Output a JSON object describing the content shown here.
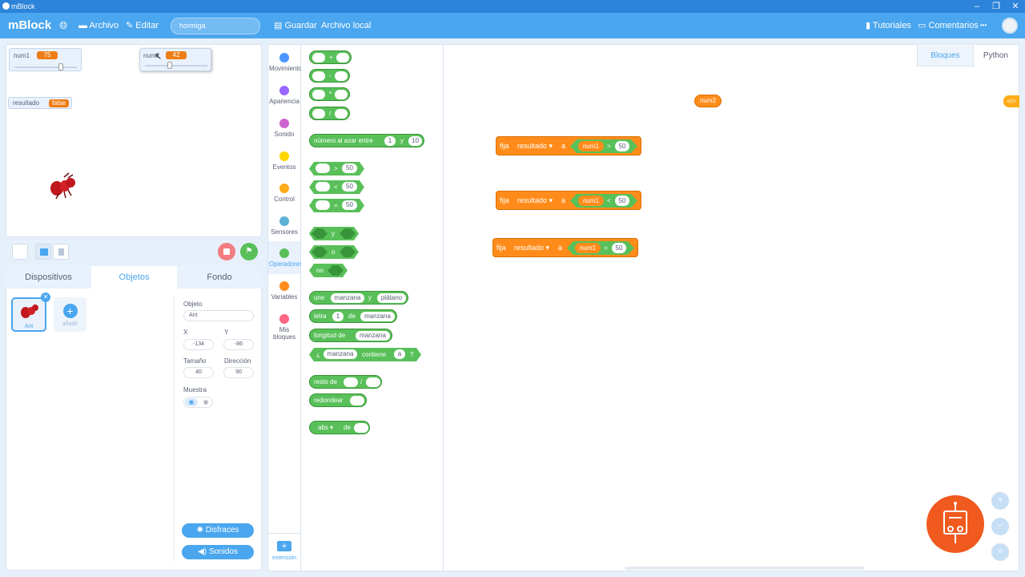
{
  "window": {
    "title": "mBlock"
  },
  "menu": {
    "logo": "mBlock",
    "file": "Archivo",
    "edit": "Editar",
    "project_name": "hormiga",
    "save": "Guardar",
    "local_file": "Archivo local",
    "tutorials": "Tutoriales",
    "comments": "Comentarios",
    "more": "•••"
  },
  "stage": {
    "monitors": [
      {
        "name": "num1",
        "value": "75"
      },
      {
        "name": "num2",
        "value": "42"
      },
      {
        "name": "resultado",
        "value": "false"
      }
    ]
  },
  "tabs": {
    "devices": "Dispositivos",
    "sprites": "Objetos",
    "background": "Fondo"
  },
  "sprite_panel": {
    "sprite_name": "Ant",
    "add_label": "añadir",
    "object_label": "Objeto",
    "object_value": "Ant",
    "x_label": "X",
    "x_value": "-134",
    "y_label": "Y",
    "y_value": "-86",
    "size_label": "Tamaño",
    "size_value": "40",
    "direction_label": "Dirección",
    "direction_value": "90",
    "show_label": "Muestra",
    "costumes_button": "Disfraces",
    "sounds_button": "Sonidos"
  },
  "categories": [
    {
      "label": "Movimiento",
      "color": "#4c97ff"
    },
    {
      "label": "Apariencia",
      "color": "#9966ff"
    },
    {
      "label": "Sonido",
      "color": "#cf63cf"
    },
    {
      "label": "Eventos",
      "color": "#ffd500"
    },
    {
      "label": "Control",
      "color": "#ffab19"
    },
    {
      "label": "Sensores",
      "color": "#5cb1d6"
    },
    {
      "label": "Operadores",
      "color": "#59c059"
    },
    {
      "label": "Variables",
      "color": "#ff8c1a"
    },
    {
      "label": "Mis bloques",
      "color": "#ff6680"
    }
  ],
  "extension_label": "extensión",
  "palette": {
    "op_add": "+",
    "op_sub": "-",
    "op_mul": "*",
    "op_div": "/",
    "random_text": "número al azar entre",
    "random_from": "1",
    "random_and": "y",
    "random_to": "10",
    "gt": ">",
    "lt": "<",
    "eq": "=",
    "fifty": "50",
    "and": "y",
    "or": "o",
    "not": "no",
    "join_text": "une",
    "join_a": "manzana",
    "join_b": "plátano",
    "letter_text": "letra",
    "letter_n": "1",
    "letter_of": "de",
    "letter_word": "manzana",
    "length_text": "longitud de",
    "length_word": "manzana",
    "contains_q": "¿",
    "contains_word": "manzana",
    "contains_text": "contiene",
    "contains_a": "a",
    "contains_end": "?",
    "mod_text": "resto de",
    "mod_div": "/",
    "round_text": "redondear",
    "abs_text": "abs ▾",
    "abs_of": "de"
  },
  "workspace": {
    "tab_blocks": "Bloques",
    "tab_python": "Python",
    "floating_var": "num2",
    "set_blocks": [
      {
        "set": "fija",
        "var": "resultado ▾",
        "to": "a",
        "left": "num1",
        "op": ">",
        "right": "50"
      },
      {
        "set": "fija",
        "var": "resultado ▾",
        "to": "a",
        "left": "num1",
        "op": "<",
        "right": "50"
      },
      {
        "set": "fija",
        "var": "resultado ▾",
        "to": "a",
        "left": "num1",
        "op": "=",
        "right": "50"
      }
    ]
  },
  "colors": {
    "accent": "#4aa6ee",
    "operators": "#59c059",
    "variables": "#ff8c1a",
    "mascot": "#f05a1e"
  }
}
